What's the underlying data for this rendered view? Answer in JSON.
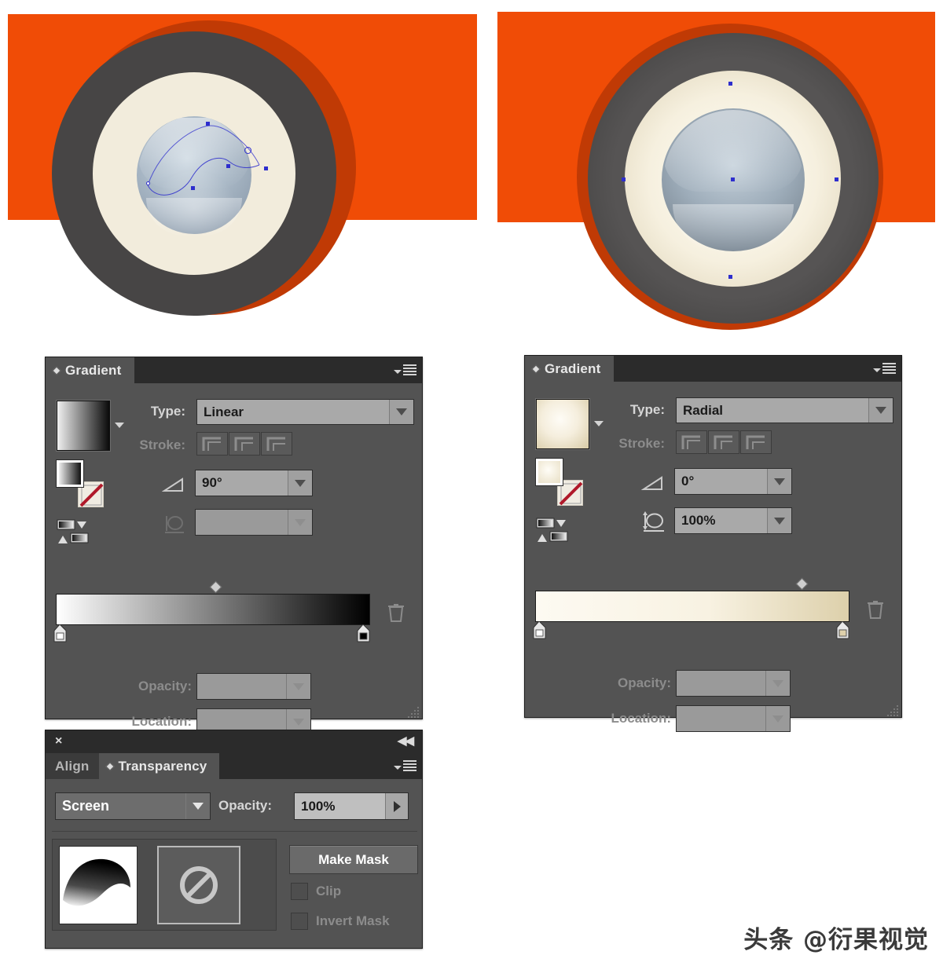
{
  "app": "Adobe Illustrator panels",
  "artwork": {
    "left": {
      "name": "linear-gradient-artwork",
      "background_color": "#f04c06",
      "shadow_color": "#c03a05",
      "ring_outer_color": "#474545",
      "ring_inner_color": "#f2ecdc",
      "sphere_colors": [
        "#9fb0c0",
        "#c6d2dc",
        "#8d9aa6"
      ],
      "anchor_color": "#2e2ecd"
    },
    "right": {
      "name": "radial-gradient-artwork",
      "background_color": "#f04c06",
      "shadow_color": "#c03a05",
      "ring_outer_color": "#474545",
      "ring_inner_color": "#f2ecdc",
      "sphere_colors": [
        "#93a2b0",
        "#c9d3dc",
        "#7e8a96"
      ],
      "anchor_color": "#2e2ecd"
    }
  },
  "gradient_panel_left": {
    "title": "Gradient",
    "type_label": "Type:",
    "type_value": "Linear",
    "stroke_label": "Stroke:",
    "angle_value": "90°",
    "aspect_value": "",
    "opacity_label": "Opacity:",
    "opacity_value": "",
    "location_label": "Location:",
    "location_value": "",
    "gradient_stops": [
      {
        "position": 0,
        "color": "#ffffff"
      },
      {
        "position": 100,
        "color": "#000000"
      }
    ],
    "midpoint": 50,
    "swatch_gradient": [
      "#ffffff",
      "#0a0a0a"
    ]
  },
  "gradient_panel_right": {
    "title": "Gradient",
    "type_label": "Type:",
    "type_value": "Radial",
    "stroke_label": "Stroke:",
    "angle_value": "0°",
    "aspect_value": "100%",
    "opacity_label": "Opacity:",
    "opacity_value": "",
    "location_label": "Location:",
    "location_value": "",
    "gradient_stops": [
      {
        "position": 0,
        "color": "#fbf8ef"
      },
      {
        "position": 100,
        "color": "#ddd0ab"
      }
    ],
    "midpoint": 82,
    "swatch_gradient": [
      "#fdfaf2",
      "#d9cca8"
    ]
  },
  "transparency_panel": {
    "tab_inactive": "Align",
    "tab_active": "Transparency",
    "blend_mode": "Screen",
    "opacity_label": "Opacity:",
    "opacity_value": "100%",
    "make_mask_label": "Make Mask",
    "clip_label": "Clip",
    "clip_checked": false,
    "invert_mask_label": "Invert Mask",
    "invert_checked": false,
    "close_icon": "×",
    "collapse_icon": "◀◀"
  },
  "watermark": {
    "text": "头条 @衍果视觉"
  },
  "colors": {
    "panel_bg": "#535353",
    "titlebar_bg": "#2b2b2b",
    "field_bg": "#a9a9a9",
    "label": "#d6d6d6",
    "label_dim": "#8c8c8c",
    "accent_orange": "#f04c06"
  }
}
